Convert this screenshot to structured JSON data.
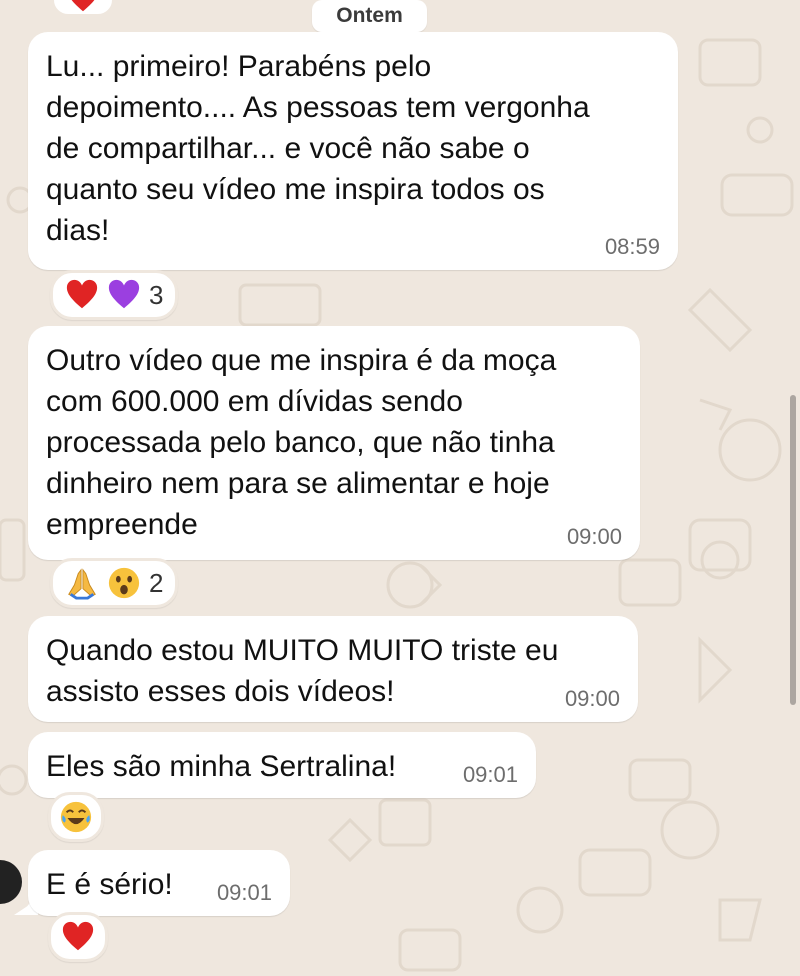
{
  "date_separator": "Ontem",
  "messages": [
    {
      "text": "Lu... primeiro! Parabéns pelo depoimento.... As pessoas tem vergonha de compartilhar... e você não sabe o quanto seu vídeo me inspira todos os dias!",
      "lines": [
        "Lu... primeiro! Parabéns pelo",
        "depoimento.... As pessoas tem vergonha",
        "de compartilhar... e você não sabe o",
        "quanto seu vídeo me inspira todos os",
        "dias!"
      ],
      "time": "08:59",
      "reactions": {
        "emojis": [
          "red-heart",
          "purple-heart"
        ],
        "count": "3"
      }
    },
    {
      "text": "Outro vídeo que me inspira é da moça com 600.000 em dívidas sendo processada pelo banco, que não tinha dinheiro nem para se alimentar e hoje empreende",
      "lines": [
        "Outro vídeo que me inspira é da moça",
        "com 600.000 em dívidas sendo",
        "processada pelo banco, que não tinha",
        "dinheiro nem para se alimentar e hoje",
        "empreende"
      ],
      "time": "09:00",
      "reactions": {
        "emojis": [
          "folded-hands",
          "surprised-face"
        ],
        "count": "2"
      }
    },
    {
      "text": "Quando estou MUITO MUITO triste eu assisto esses dois vídeos!",
      "lines": [
        "Quando estou MUITO MUITO triste eu",
        "assisto esses dois vídeos!"
      ],
      "time": "09:00"
    },
    {
      "text": "Eles são minha Sertralina!",
      "lines": [
        "Eles são minha Sertralina!"
      ],
      "time": "09:01",
      "reactions": {
        "emojis": [
          "tears-of-joy"
        ]
      }
    },
    {
      "text": "E é sério!",
      "lines": [
        "E é sério!"
      ],
      "time": "09:01",
      "reactions": {
        "emojis": [
          "red-heart"
        ]
      }
    }
  ],
  "colors": {
    "background": "#efe7de",
    "bubble": "#ffffff",
    "time_text": "#6d6d6d"
  }
}
